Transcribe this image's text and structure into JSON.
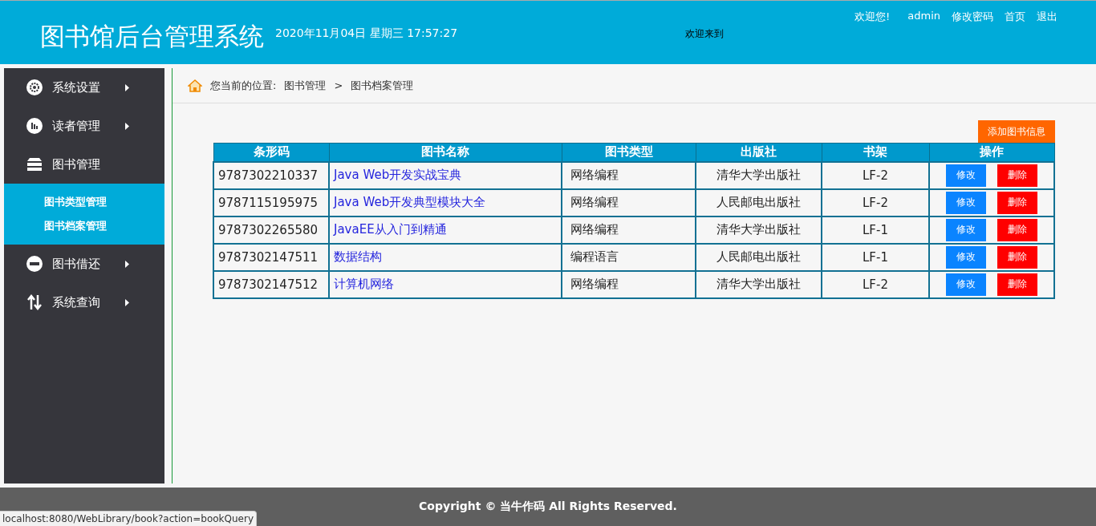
{
  "header": {
    "title": "图书馆后台管理系统",
    "datetime": "2020年11月04日 星期三 17:57:27",
    "welcome_center": "欢迎来到",
    "greeting": "欢迎您!",
    "user": "admin",
    "links": [
      "修改密码",
      "首页",
      "退出"
    ]
  },
  "sidebar": {
    "items": [
      {
        "label": "系统设置",
        "expanded": false
      },
      {
        "label": "读者管理",
        "expanded": false
      },
      {
        "label": "图书管理",
        "expanded": true,
        "children": [
          {
            "label": "图书类型管理"
          },
          {
            "label": "图书档案管理"
          }
        ]
      },
      {
        "label": "图书借还",
        "expanded": false
      },
      {
        "label": "系统查询",
        "expanded": false
      }
    ]
  },
  "breadcrumb": {
    "prefix": "您当前的位置:",
    "items": [
      "图书管理",
      "图书档案管理"
    ],
    "separator": ">"
  },
  "add_button": "添加图书信息",
  "table": {
    "columns": [
      "条形码",
      "图书名称",
      "图书类型",
      "出版社",
      "书架",
      "操作"
    ],
    "rows": [
      {
        "barcode": "9787302210337",
        "name": "Java Web开发实战宝典",
        "type": "网络编程",
        "publisher": "清华大学出版社",
        "shelf": "LF-2",
        "edit": "修改",
        "delete": "删除"
      },
      {
        "barcode": "9787115195975",
        "name": "Java Web开发典型模块大全",
        "type": "网络编程",
        "publisher": "人民邮电出版社",
        "shelf": "LF-2",
        "edit": "修改",
        "delete": "删除"
      },
      {
        "barcode": "9787302265580",
        "name": "JavaEE从入门到精通",
        "type": "网络编程",
        "publisher": "清华大学出版社",
        "shelf": "LF-1",
        "edit": "修改",
        "delete": "删除"
      },
      {
        "barcode": "9787302147511",
        "name": "数据结构",
        "type": "编程语言",
        "publisher": "人民邮电出版社",
        "shelf": "LF-1",
        "edit": "修改",
        "delete": "删除"
      },
      {
        "barcode": "9787302147512",
        "name": "计算机网络",
        "type": "网络编程",
        "publisher": "清华大学出版社",
        "shelf": "LF-2",
        "edit": "修改",
        "delete": "删除"
      }
    ]
  },
  "footer": "Copyright © 当牛作码 All Rights Reserved.",
  "status_bar": "localhost:8080/WebLibrary/book?action=bookQuery"
}
